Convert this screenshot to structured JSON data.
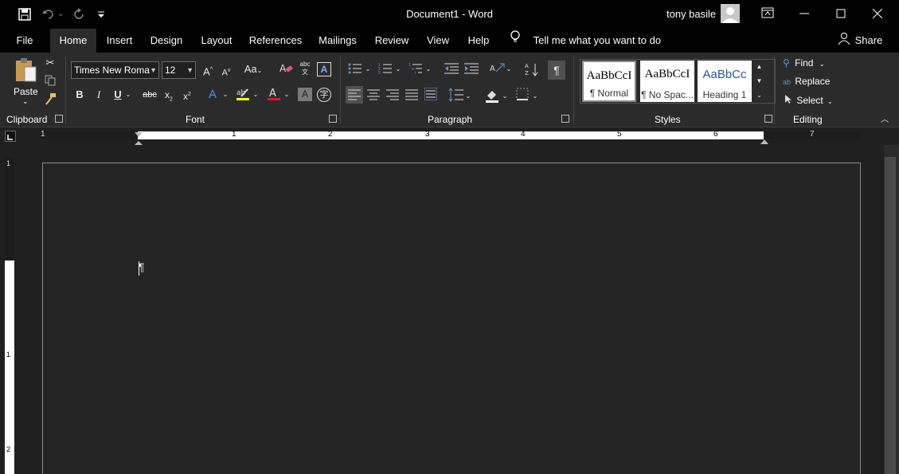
{
  "titlebar": {
    "title": "Document1  -  Word",
    "user_name": "tony basile",
    "undo_dropdown": "⌄"
  },
  "tabs": [
    "File",
    "Home",
    "Insert",
    "Design",
    "Layout",
    "References",
    "Mailings",
    "Review",
    "View",
    "Help"
  ],
  "tellme": "Tell me what you want to do",
  "share": "Share",
  "clipboard": {
    "paste_label": "Paste",
    "group_label": "Clipboard"
  },
  "font": {
    "name": "Times New Roma",
    "size": "12",
    "group_label": "Font"
  },
  "paragraph": {
    "group_label": "Paragraph"
  },
  "styles": {
    "group_label": "Styles",
    "items": [
      {
        "preview": "AaBbCcI",
        "name": "¶ Normal"
      },
      {
        "preview": "AaBbCcI",
        "name": "¶ No Spac..."
      },
      {
        "preview": "AaBbCc",
        "name": "Heading 1"
      }
    ]
  },
  "editing": {
    "group_label": "Editing",
    "find": "Find",
    "replace": "Replace",
    "select": "Select"
  },
  "ruler": {
    "numbers": [
      "1",
      "1",
      "2",
      "3",
      "4",
      "5",
      "6",
      "7"
    ],
    "vertical": [
      "1",
      "1",
      "2"
    ]
  },
  "colors": {
    "accent_font_red": "#e81123",
    "highlight_yellow": "#ffff00"
  }
}
